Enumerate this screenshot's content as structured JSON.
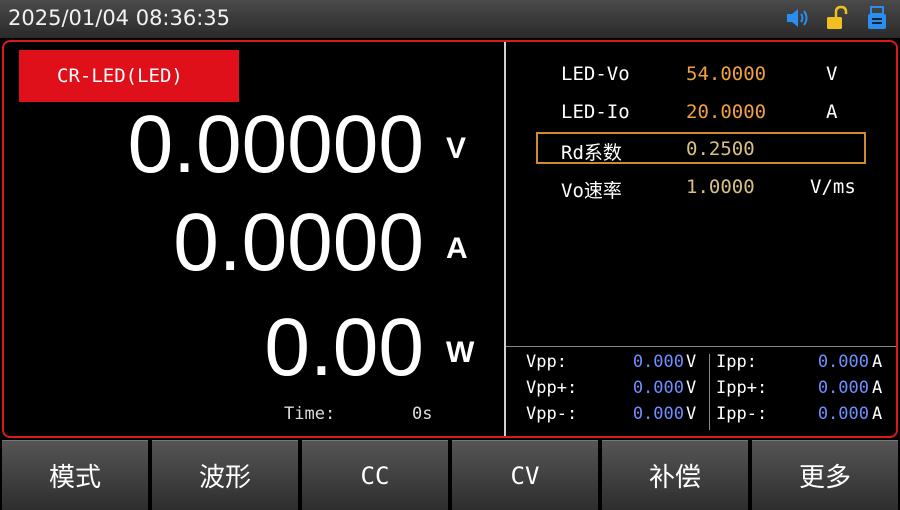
{
  "status_bar": {
    "datetime": "2025/01/04  08:36:35",
    "icons": [
      "speaker-icon",
      "unlock-icon",
      "usb-drive-icon"
    ],
    "colors": {
      "speaker": "#2a8df0",
      "lock": "#f0c020",
      "usb": "#2a8df0"
    }
  },
  "mode": {
    "label": "CR-LED(LED)",
    "color": "#e0101a"
  },
  "readings": {
    "voltage": {
      "value": "0.00000",
      "unit": "V"
    },
    "current": {
      "value": "0.0000",
      "unit": "A"
    },
    "power": {
      "value": "0.00",
      "unit": "W"
    }
  },
  "time": {
    "label": "Time:",
    "value": "0s"
  },
  "params": [
    {
      "name": "LED-Vo",
      "value": "54.0000",
      "unit": "V"
    },
    {
      "name": "LED-Io",
      "value": "20.0000",
      "unit": "A"
    },
    {
      "name": "Rd系数",
      "value": "0.2500",
      "unit": "",
      "selected": true
    },
    {
      "name": "Vo速率",
      "value": "1.0000",
      "unit": "V/ms"
    }
  ],
  "ripple": {
    "rows": [
      {
        "vlabel": "Vpp:",
        "vvalue": "0.000",
        "vunit": "V",
        "ilabel": "Ipp:",
        "ivalue": "0.000",
        "iunit": "A"
      },
      {
        "vlabel": "Vpp+:",
        "vvalue": "0.000",
        "vunit": "V",
        "ilabel": "Ipp+:",
        "ivalue": "0.000",
        "iunit": "A"
      },
      {
        "vlabel": "Vpp-:",
        "vvalue": "0.000",
        "vunit": "V",
        "ilabel": "Ipp-:",
        "ivalue": "0.000",
        "iunit": "A"
      }
    ]
  },
  "softkeys": [
    "模式",
    "波形",
    "CC",
    "CV",
    "补偿",
    "更多"
  ]
}
